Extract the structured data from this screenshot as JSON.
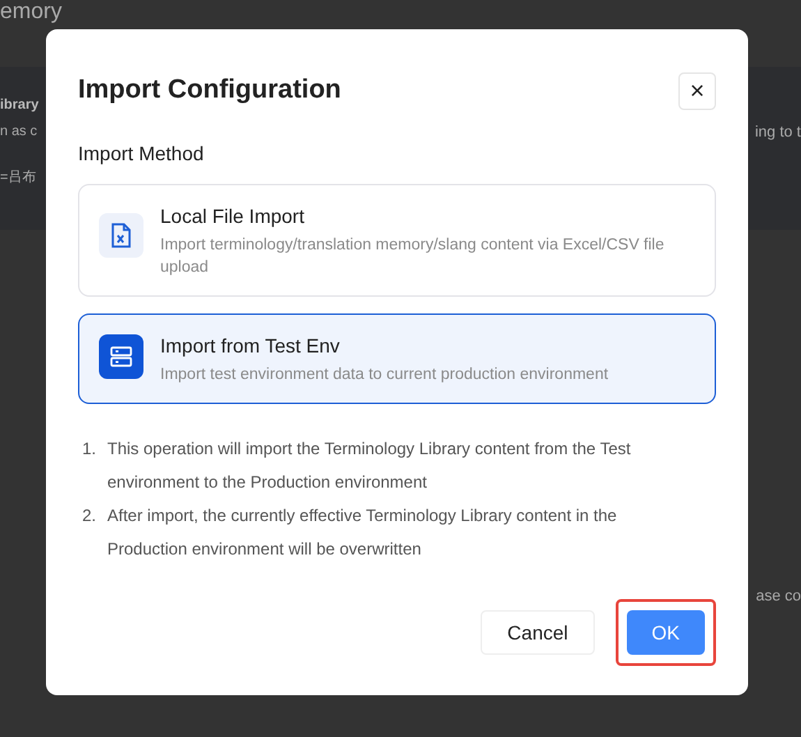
{
  "background": {
    "top_fragment": "emory",
    "heading_fragment": "ibrary",
    "line_left_fragment": "n as c",
    "line_right_fragment": "ing to t",
    "value_fragment": "=吕布",
    "side_fragment": "ase co"
  },
  "dialog": {
    "title": "Import Configuration",
    "close": "×",
    "section_label": "Import Method",
    "options": [
      {
        "kind": "file",
        "title": "Local File Import",
        "description": "Import terminology/translation memory/slang content via Excel/CSV file upload",
        "selected": false
      },
      {
        "kind": "server",
        "title": "Import from Test Env",
        "description": "Import test environment data to current production environment",
        "selected": true
      }
    ],
    "notes": [
      {
        "number": "1.",
        "text": "This operation will import the Terminology Library content from the Test environment to the Production environment"
      },
      {
        "number": "2.",
        "text": "After import, the currently effective Terminology Library content in the Production environment will be overwritten"
      }
    ],
    "buttons": [
      {
        "kind": "secondary",
        "label": "Cancel",
        "highlighted": false
      },
      {
        "kind": "primary",
        "label": "OK",
        "highlighted": true
      }
    ]
  }
}
